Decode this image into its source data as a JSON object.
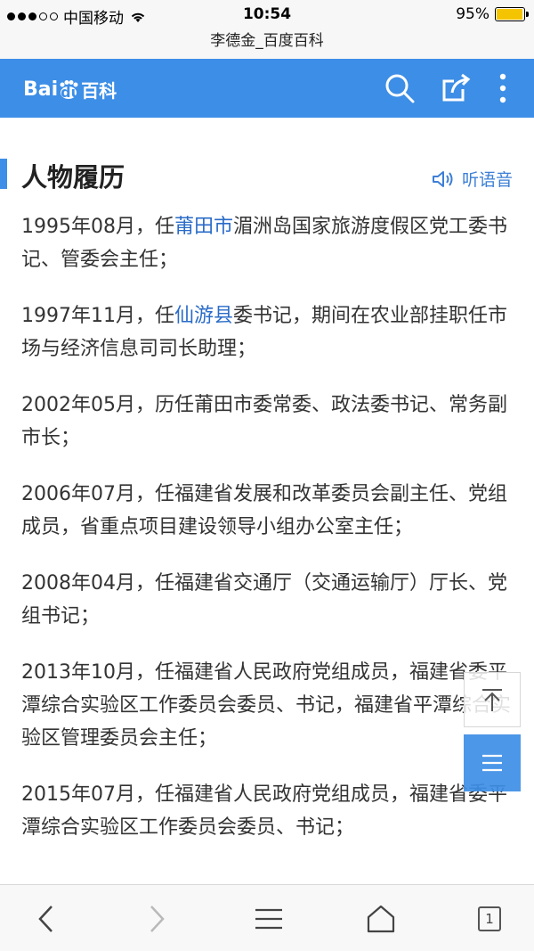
{
  "status_bar": {
    "carrier": "中国移动",
    "time": "10:54",
    "battery": "95%",
    "battery_level": 0.95
  },
  "browser": {
    "page_title": "李德金_百度百科"
  },
  "header": {
    "logo_text_bai": "Bai",
    "logo_text_du": "du",
    "logo_text_baike": "百科",
    "search_icon": "search-icon",
    "share_icon": "share-icon",
    "more_icon": "more-vertical-icon",
    "accent_color": "#3d8ee6"
  },
  "section": {
    "title": "人物履历",
    "listen_label": "听语音"
  },
  "entries": [
    {
      "pre": "1995年08月，任",
      "link": "莆田市",
      "post": "湄洲岛国家旅游度假区党工委书记、管委会主任；"
    },
    {
      "pre": "1997年11月，任",
      "link": "仙游县",
      "post": "委书记，期间在农业部挂职任市场与经济信息司司长助理；"
    },
    {
      "pre": "2002年05月，历任莆田市委常委、政法委书记、常务副市长；",
      "link": "",
      "post": ""
    },
    {
      "pre": "2006年07月，任福建省发展和改革委员会副主任、党组成员，省重点项目建设领导小组办公室主任；",
      "link": "",
      "post": ""
    },
    {
      "pre": "2008年04月，任福建省交通厅（交通运输厅）厅长、党组书记；",
      "link": "",
      "post": ""
    },
    {
      "pre": "2013年10月，任福建省人民政府党组成员，福建省委平潭综合实验区工作委员会委员、书记，福建省平潭综合实验区管理委员会主任；",
      "link": "",
      "post": ""
    },
    {
      "pre": "2015年07月，任福建省人民政府党组成员，福建省委平潭综合实验区工作委员会委员、书记；",
      "link": "",
      "post": ""
    }
  ],
  "bottom_bar": {
    "tab_count": "1"
  }
}
